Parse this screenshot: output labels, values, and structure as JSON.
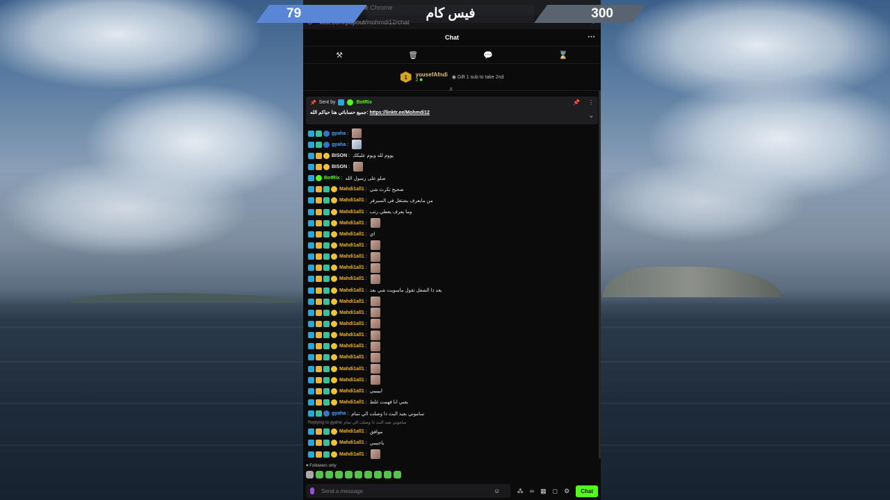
{
  "overlay": {
    "score_left": "79",
    "title": "فيس كام",
    "score_right": "300",
    "color_left": "#5a86d8",
    "color_right": "#5a6470"
  },
  "browser": {
    "title": "hmdi12/chat - Google Chrome",
    "url": "kick.com/popout/mohmdi12/chat"
  },
  "chat": {
    "header_title": "Chat",
    "toolbar_icons": [
      "hammer-icon",
      "trash-icon",
      "chat-icon",
      "hourglass-icon"
    ],
    "leaderboard": {
      "rank": "1",
      "username": "yousefAfndi",
      "count": "2",
      "gift_text": "Gift 1 sub to take 2nd"
    },
    "pinned": {
      "sent_by_label": "Sent by",
      "bot_name": "BotRix",
      "text": "جميع حساباتي هنا حياكم الله:",
      "link": "https://linktr.ee/Mohmdi12"
    },
    "messages": [
      {
        "user": "gyaha",
        "color": "u-blue",
        "badges": [
          "mod",
          "og",
          "ver"
        ],
        "text": "",
        "emote": "e1"
      },
      {
        "user": "gyaha",
        "color": "u-blue",
        "badges": [
          "mod",
          "og",
          "ver"
        ],
        "text": "",
        "emote": "e2"
      },
      {
        "user": "BISON",
        "color": "u-white",
        "badges": [
          "mod",
          "vip",
          "sub"
        ],
        "text": "يووم لله ويوم عليكك",
        "emote": ""
      },
      {
        "user": "BISON",
        "color": "u-white",
        "badges": [
          "mod",
          "vip",
          "sub"
        ],
        "text": "",
        "emote": "e1"
      },
      {
        "user": "BotRix",
        "color": "u-green",
        "badges": [
          "mod",
          "bot"
        ],
        "text": "صلو على رسول الله",
        "emote": ""
      },
      {
        "user": "Mahdi1all1",
        "color": "u-orange",
        "badges": [
          "mod",
          "vip",
          "og",
          "sub"
        ],
        "text": "صحيح تكرث شي",
        "emote": ""
      },
      {
        "user": "Mahdi1all1",
        "color": "u-orange",
        "badges": [
          "mod",
          "vip",
          "og",
          "sub"
        ],
        "text": "من مايعرف يشتغل في السيرفر",
        "emote": ""
      },
      {
        "user": "Mahdi1all1",
        "color": "u-orange",
        "badges": [
          "mod",
          "vip",
          "og",
          "sub"
        ],
        "text": "وما يعرف يعطي رتب",
        "emote": ""
      },
      {
        "user": "Mahdi1all1",
        "color": "u-orange",
        "badges": [
          "mod",
          "vip",
          "og",
          "sub"
        ],
        "text": "",
        "emote": "e1"
      },
      {
        "user": "Mahdi1all1",
        "color": "u-orange",
        "badges": [
          "mod",
          "vip",
          "og",
          "sub"
        ],
        "text": "اي",
        "emote": ""
      },
      {
        "user": "Mahdi1all1",
        "color": "u-orange",
        "badges": [
          "mod",
          "vip",
          "og",
          "sub"
        ],
        "text": "",
        "emote": "e1"
      },
      {
        "user": "Mahdi1all1",
        "color": "u-orange",
        "badges": [
          "mod",
          "vip",
          "og",
          "sub"
        ],
        "text": "",
        "emote": "e1"
      },
      {
        "user": "Mahdi1all1",
        "color": "u-orange",
        "badges": [
          "mod",
          "vip",
          "og",
          "sub"
        ],
        "text": "",
        "emote": "e1"
      },
      {
        "user": "Mahdi1all1",
        "color": "u-orange",
        "badges": [
          "mod",
          "vip",
          "og",
          "sub"
        ],
        "text": "",
        "emote": "e1"
      },
      {
        "user": "Mahdi1all1",
        "color": "u-orange",
        "badges": [
          "mod",
          "vip",
          "og",
          "sub"
        ],
        "text": "بعد ذا الشغل تقول ماسويت شي بعد",
        "emote": ""
      },
      {
        "user": "Mahdi1all1",
        "color": "u-orange",
        "badges": [
          "mod",
          "vip",
          "og",
          "sub"
        ],
        "text": "",
        "emote": "e1"
      },
      {
        "user": "Mahdi1all1",
        "color": "u-orange",
        "badges": [
          "mod",
          "vip",
          "og",
          "sub"
        ],
        "text": "",
        "emote": "e1"
      },
      {
        "user": "Mahdi1all1",
        "color": "u-orange",
        "badges": [
          "mod",
          "vip",
          "og",
          "sub"
        ],
        "text": "",
        "emote": "e1"
      },
      {
        "user": "Mahdi1all1",
        "color": "u-orange",
        "badges": [
          "mod",
          "vip",
          "og",
          "sub"
        ],
        "text": "",
        "emote": "e1"
      },
      {
        "user": "Mahdi1all1",
        "color": "u-orange",
        "badges": [
          "mod",
          "vip",
          "og",
          "sub"
        ],
        "text": "",
        "emote": "e1"
      },
      {
        "user": "Mahdi1all1",
        "color": "u-orange",
        "badges": [
          "mod",
          "vip",
          "og",
          "sub"
        ],
        "text": "",
        "emote": "e1"
      },
      {
        "user": "Mahdi1all1",
        "color": "u-orange",
        "badges": [
          "mod",
          "vip",
          "og",
          "sub"
        ],
        "text": "",
        "emote": "e1"
      },
      {
        "user": "Mahdi1all1",
        "color": "u-orange",
        "badges": [
          "mod",
          "vip",
          "og",
          "sub"
        ],
        "text": "",
        "emote": "e1"
      },
      {
        "user": "Mahdi1all1",
        "color": "u-orange",
        "badges": [
          "mod",
          "vip",
          "og",
          "sub"
        ],
        "text": "ايييييي",
        "emote": ""
      },
      {
        "user": "Mahdi1all1",
        "color": "u-orange",
        "badges": [
          "mod",
          "vip",
          "og",
          "sub"
        ],
        "text": "يعني انا فهمت غلط",
        "emote": ""
      },
      {
        "user": "gyaha",
        "color": "u-blue",
        "badges": [
          "mod",
          "og",
          "ver"
        ],
        "text": "ساموني بعيد البث ذا وصلت الي تمام",
        "emote": ""
      },
      {
        "user": "Mahdi1all1",
        "color": "u-orange",
        "badges": [
          "mod",
          "vip",
          "og",
          "sub"
        ],
        "text": "موافق",
        "emote": "",
        "reply": "Replying to gyaha: ساموني بعيد البث ذا وصلت الي تمام"
      },
      {
        "user": "Mahdi1all1",
        "color": "u-orange",
        "badges": [
          "mod",
          "vip",
          "og",
          "sub"
        ],
        "text": "ياحبيبي",
        "emote": ""
      },
      {
        "user": "Mahdi1all1",
        "color": "u-orange",
        "badges": [
          "mod",
          "vip",
          "og",
          "sub"
        ],
        "text": "",
        "emote": "e1"
      }
    ],
    "followers_label": "Followers only",
    "input_placeholder": "Send a message",
    "chat_button": "Chat",
    "accent": "#53fc18"
  }
}
